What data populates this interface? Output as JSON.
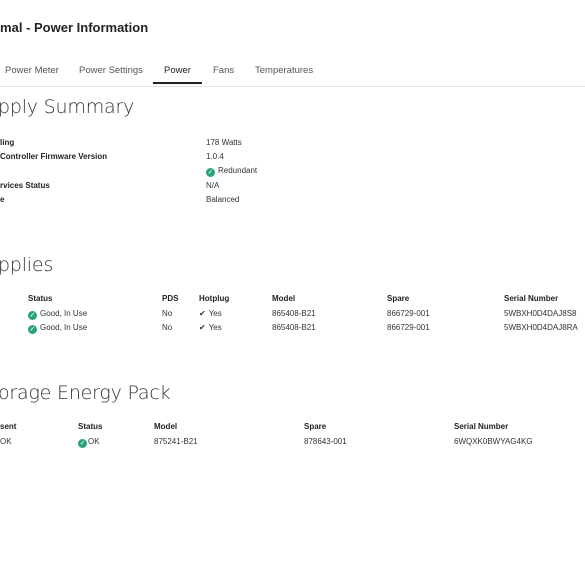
{
  "header": {
    "title": "rmal - Power Information"
  },
  "tabs": [
    {
      "label": "Power Meter"
    },
    {
      "label": "Power Settings"
    },
    {
      "label": "Power"
    },
    {
      "label": "Fans"
    },
    {
      "label": "Temperatures"
    }
  ],
  "summary": {
    "heading": "pply Summary",
    "rows": [
      {
        "label": "ling",
        "value": "178 Watts"
      },
      {
        "label": "Controller Firmware Version",
        "value": "1.0.4"
      },
      {
        "label": "",
        "value": "Redundant"
      },
      {
        "label": "rvices Status",
        "value": "N/A"
      },
      {
        "label": "e",
        "value": "Balanced"
      }
    ]
  },
  "supplies": {
    "heading": "pplies",
    "headers": {
      "status": "Status",
      "pds": "PDS",
      "hotplug": "Hotplug",
      "model": "Model",
      "spare": "Spare",
      "serial": "Serial Number"
    },
    "rows": [
      {
        "status": "Good, In Use",
        "pds": "No",
        "hotplug": "Yes",
        "model": "865408-B21",
        "spare": "866729-001",
        "serial": "5WBXH0D4DAJ8S8"
      },
      {
        "status": "Good, In Use",
        "pds": "No",
        "hotplug": "Yes",
        "model": "865408-B21",
        "spare": "866729-001",
        "serial": "5WBXH0D4DAJ8RA"
      }
    ]
  },
  "energy": {
    "heading": "orage Energy Pack",
    "headers": {
      "present": "sent",
      "status": "Status",
      "model": "Model",
      "spare": "Spare",
      "serial": "Serial Number"
    },
    "row": {
      "present": "OK",
      "status": "OK",
      "model": "875241-B21",
      "spare": "878643-001",
      "serial": "6WQXK0BWYAG4KG"
    }
  },
  "icons": {
    "ok": "ok-check-circle-icon",
    "check": "check-icon"
  },
  "colors": {
    "ok": "#2aa37a"
  }
}
